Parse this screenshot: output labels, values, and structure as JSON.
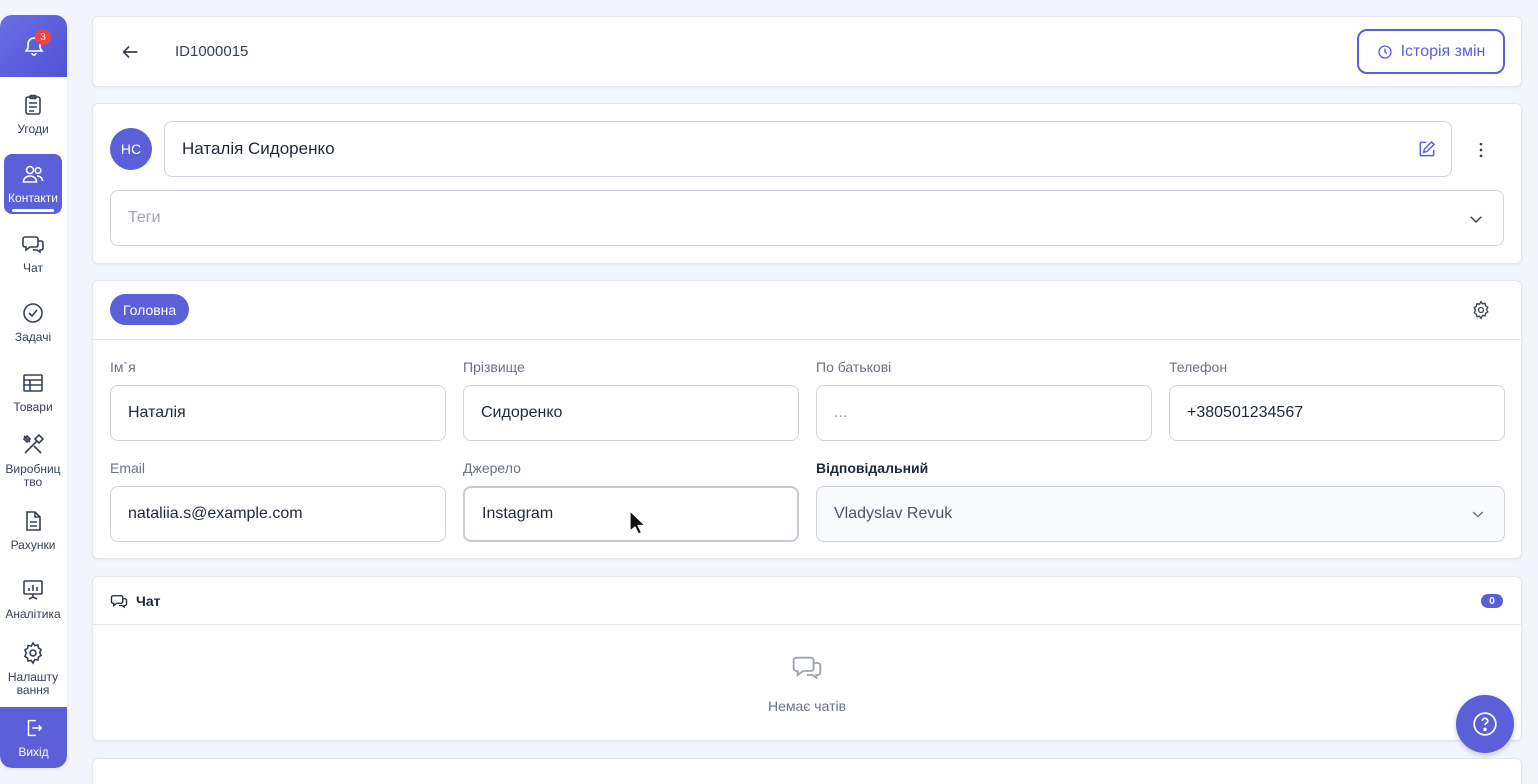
{
  "sidebar": {
    "notification_count": "3",
    "items": [
      {
        "label": "Угоди",
        "icon": "clipboard-icon"
      },
      {
        "label": "Контакти",
        "icon": "users-icon"
      },
      {
        "label": "Чат",
        "icon": "chat-icon"
      },
      {
        "label": "Задачі",
        "icon": "check-circle-icon"
      },
      {
        "label": "Товари",
        "icon": "table-icon"
      },
      {
        "label": "Виробництво",
        "label_line1": "Виробниц",
        "label_line2": "тво",
        "icon": "tools-icon"
      },
      {
        "label": "Рахунки",
        "icon": "document-icon"
      },
      {
        "label": "Аналітика",
        "icon": "presentation-chart-icon"
      },
      {
        "label": "Налаштування",
        "label_line1": "Налашту",
        "label_line2": "вання",
        "icon": "gear-icon"
      }
    ],
    "exit_label": "Вихід"
  },
  "header": {
    "contact_id": "ID1000015",
    "history_label": "Історія змін"
  },
  "contact": {
    "initials": "НС",
    "full_name": "Наталія Сидоренко",
    "tags_placeholder": "Теги"
  },
  "main": {
    "tab_label": "Головна",
    "fields": {
      "first_name": {
        "label": "Ім`я",
        "value": "Наталія"
      },
      "last_name": {
        "label": "Прізвище",
        "value": "Сидоренко"
      },
      "patronymic": {
        "label": "По батькові",
        "placeholder": "..."
      },
      "phone": {
        "label": "Телефон",
        "value": "+380501234567"
      },
      "email": {
        "label": "Email",
        "value": "nataliia.s@example.com"
      },
      "source": {
        "label": "Джерело",
        "value": "Instagram"
      },
      "responsible": {
        "label": "Відповідальний",
        "value": "Vladyslav Revuk"
      }
    }
  },
  "chat": {
    "title": "Чат",
    "count": "0",
    "empty_text": "Немає чатів"
  },
  "colors": {
    "accent": "#5b5fd8",
    "badge": "#ef4444"
  }
}
